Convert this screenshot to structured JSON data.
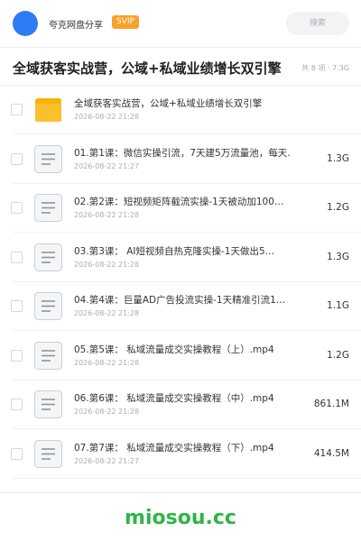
{
  "header": {
    "brand": "夸克网盘分享",
    "badge": "SVIP",
    "search_placeholder": "搜索"
  },
  "folder": {
    "title": "全域获客实战营，公域+私域业绩增长双引擎",
    "meta": "共 8 项 · 7.3G"
  },
  "items": [
    {
      "type": "folder-icon",
      "name": "全域获客实战营，公域+私域业绩增长双引擎",
      "date": "2026-08-22 21:28",
      "size": ""
    },
    {
      "type": "document-icon",
      "name": "01.第1课：微信实操引流，7天建5万流量池，每天…",
      "date": "2026-08-22 21:27",
      "size": "1.3G"
    },
    {
      "type": "document-icon",
      "name": "02.第2课：短视频矩阵截流实操-1天被动加100…",
      "date": "2026-08-22 21:28",
      "size": "1.2G"
    },
    {
      "type": "document-icon",
      "name": "03.第3课： AI短视频自热克隆实操-1天做出5…",
      "date": "2026-08-22 21:28",
      "size": "1.3G"
    },
    {
      "type": "document-icon",
      "name": "04.第4课：巨量AD广告投流实操-1天精准引流1…",
      "date": "2026-08-22 21:28",
      "size": "1.1G"
    },
    {
      "type": "document-icon",
      "name": "05.第5课： 私域流量成交实操教程（上）.mp4",
      "date": "2026-08-22 21:28",
      "size": "1.2G"
    },
    {
      "type": "document-icon",
      "name": "06.第6课： 私域流量成交实操教程（中）.mp4",
      "date": "2026-08-22 21:28",
      "size": "861.1M"
    },
    {
      "type": "document-icon",
      "name": "07.第7课： 私域流量成交实操教程（下）.mp4",
      "date": "2026-08-22 21:27",
      "size": "414.5M"
    }
  ],
  "watermark": "miosou.cc",
  "colors": {
    "accent": "#2f7bf6",
    "svip": "#f8a12a",
    "folder": "#fbc02d",
    "watermark": "#2fb44a"
  }
}
